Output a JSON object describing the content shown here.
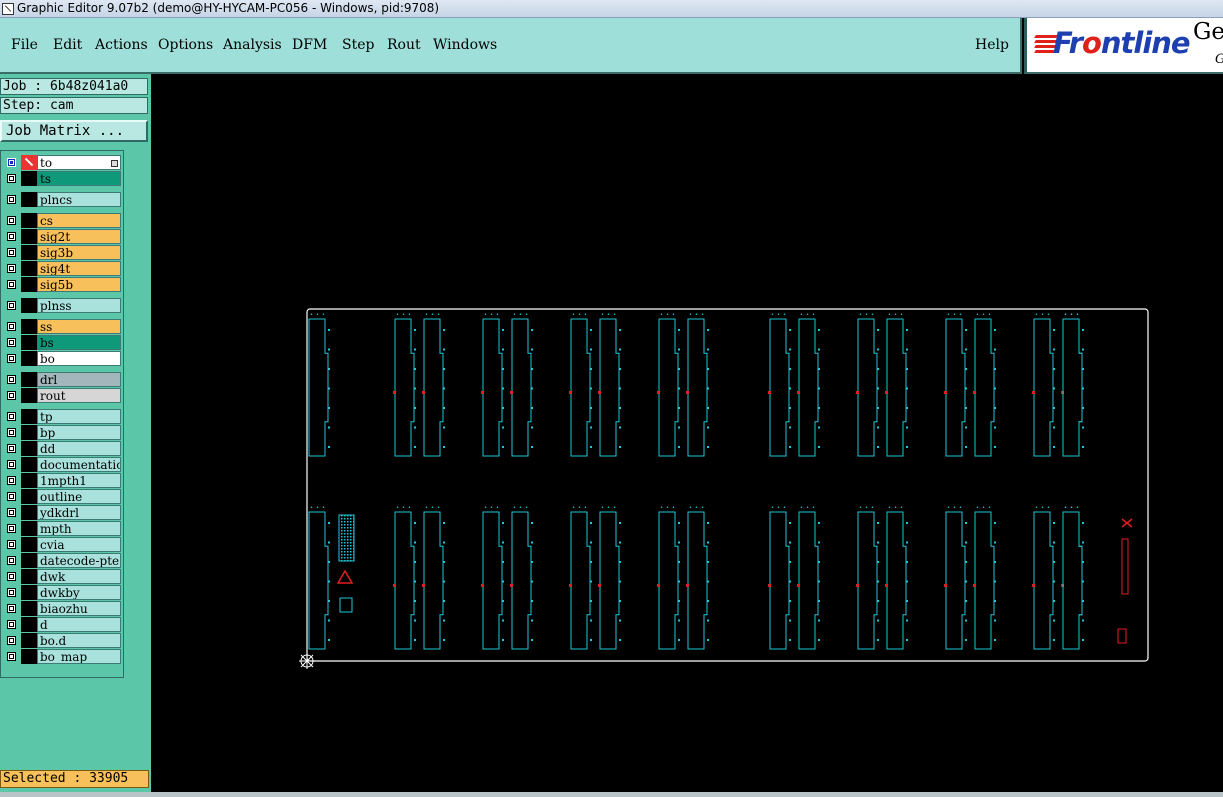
{
  "window": {
    "title": "Graphic Editor 9.07b2 (demo@HY-HYCAM-PC056 - Windows, pid:9708)"
  },
  "menu": [
    {
      "label": "File",
      "name": "menu-file"
    },
    {
      "label": "Edit",
      "name": "menu-edit"
    },
    {
      "label": "Actions",
      "name": "menu-actions"
    },
    {
      "label": "Options",
      "name": "menu-options"
    },
    {
      "label": "Analysis",
      "name": "menu-analysis"
    },
    {
      "label": "DFM",
      "name": "menu-dfm"
    },
    {
      "label": "Step",
      "name": "menu-step"
    },
    {
      "label": "Rout",
      "name": "menu-rout"
    },
    {
      "label": "Windows",
      "name": "menu-windows"
    }
  ],
  "help_label": "Help",
  "logo": {
    "prefix": "Fr",
    "accent": "o",
    "suffix": "ntline",
    "extra": "Ge",
    "extra2": "G"
  },
  "job": {
    "job_text": "Job : 6b48z041a0",
    "step_text": "Step: cam",
    "matrix_button": "Job Matrix ..."
  },
  "layers": [
    {
      "name": "to",
      "color": "#ffffff",
      "checked": true,
      "active": true,
      "selected": true
    },
    {
      "name": "ts",
      "color": "#0e9a7a"
    },
    {
      "name": "plncs",
      "color": "#a9e2dc"
    },
    {
      "name": "cs",
      "color": "#f7c05b"
    },
    {
      "name": "sig2t",
      "color": "#f7c05b"
    },
    {
      "name": "sig3b",
      "color": "#f7c05b"
    },
    {
      "name": "sig4t",
      "color": "#f7c05b"
    },
    {
      "name": "sig5b",
      "color": "#f7c05b"
    },
    {
      "name": "plnss",
      "color": "#a9e2dc"
    },
    {
      "name": "ss",
      "color": "#f7c05b"
    },
    {
      "name": "bs",
      "color": "#0e9a7a"
    },
    {
      "name": "bo",
      "color": "#ffffff"
    },
    {
      "name": "drl",
      "color": "#a3b6bb"
    },
    {
      "name": "rout",
      "color": "#d6d6d6"
    },
    {
      "name": "tp",
      "color": "#a9e2dc"
    },
    {
      "name": "bp",
      "color": "#a9e2dc"
    },
    {
      "name": "dd",
      "color": "#a9e2dc"
    },
    {
      "name": "documentation",
      "color": "#a9e2dc"
    },
    {
      "name": "1mpth1",
      "color": "#a9e2dc"
    },
    {
      "name": "outline",
      "color": "#a9e2dc"
    },
    {
      "name": "ydkdrl",
      "color": "#a9e2dc"
    },
    {
      "name": "mpth",
      "color": "#a9e2dc"
    },
    {
      "name": "cvia",
      "color": "#a9e2dc"
    },
    {
      "name": "datecode-pte",
      "color": "#a9e2dc"
    },
    {
      "name": "dwk",
      "color": "#a9e2dc"
    },
    {
      "name": "dwkby",
      "color": "#a9e2dc"
    },
    {
      "name": "biaozhu",
      "color": "#a9e2dc"
    },
    {
      "name": "d",
      "color": "#a9e2dc"
    },
    {
      "name": "bo.d",
      "color": "#a9e2dc"
    },
    {
      "name": "bo_map",
      "color": "#a9e2dc"
    }
  ],
  "status": {
    "selected_text": "Selected : 33905"
  },
  "colors": {
    "outline": "#ffffff",
    "feature": "#1ec8d8",
    "marker": "#e02020"
  }
}
